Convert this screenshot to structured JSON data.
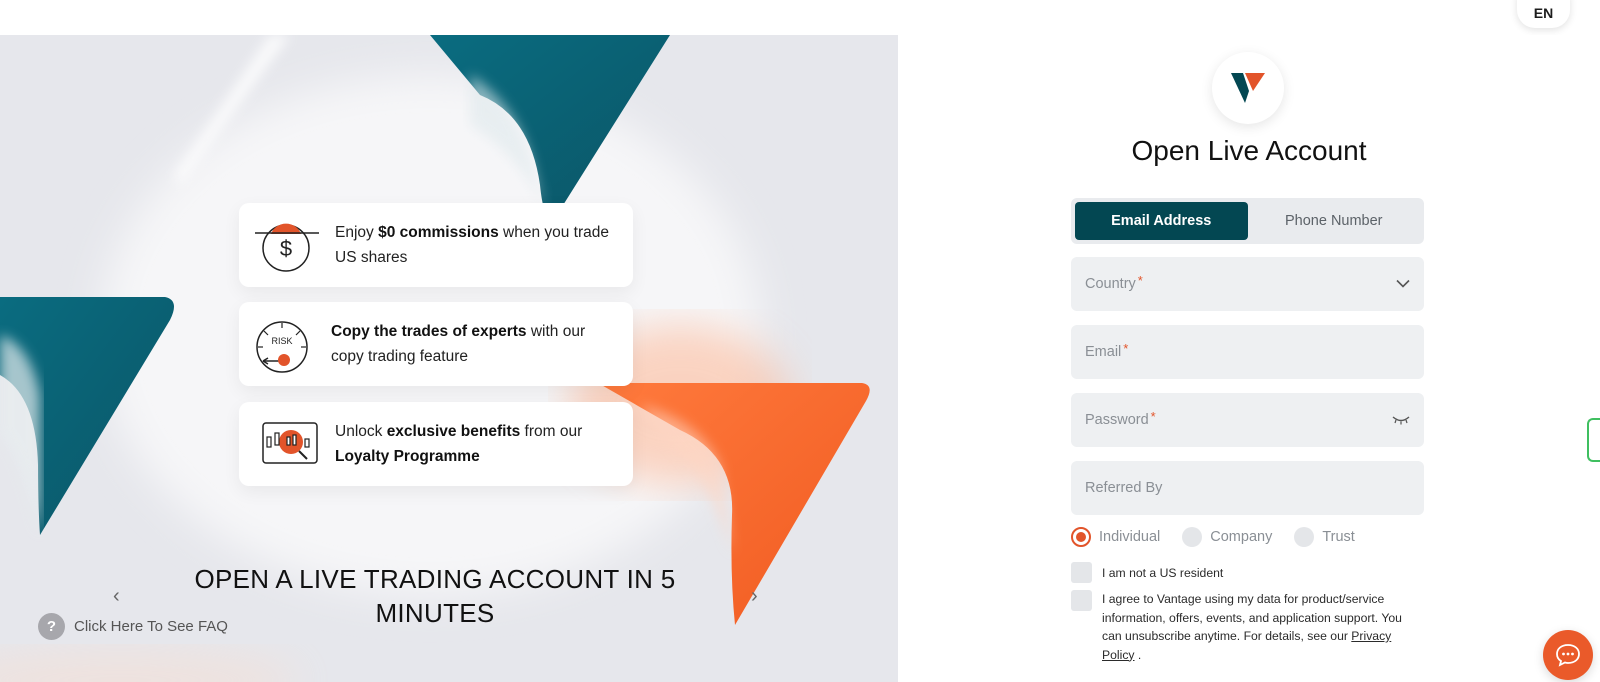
{
  "header": {
    "language": "EN"
  },
  "hero": {
    "features": [
      {
        "icon": "dollar-coin-icon",
        "pre": "Enjoy ",
        "bold": "$0 commissions",
        "post": " when you trade US shares"
      },
      {
        "icon": "risk-gauge-icon",
        "pre": "",
        "bold": "Copy the trades of experts",
        "post": " with our copy trading feature"
      },
      {
        "icon": "loyalty-chart-icon",
        "pre": "Unlock ",
        "bold": "exclusive benefits",
        "post": " from our ",
        "bold2": "Loyalty Programme"
      }
    ],
    "risk_label": "RISK",
    "title": "OPEN A LIVE TRADING ACCOUNT IN 5 MINUTES",
    "prev_arrow": "‹",
    "next_arrow": "›",
    "faq": {
      "icon": "?",
      "label": "Click Here To See FAQ"
    }
  },
  "form": {
    "title": "Open Live Account",
    "tabs": [
      {
        "label": "Email Address",
        "active": true
      },
      {
        "label": "Phone Number",
        "active": false
      }
    ],
    "fields": {
      "country": {
        "placeholder": "Country",
        "required": "*"
      },
      "email": {
        "placeholder": "Email",
        "required": "*"
      },
      "password": {
        "placeholder": "Password",
        "required": "*"
      },
      "referred_by": {
        "placeholder": "Referred By"
      }
    },
    "account_types": [
      {
        "label": "Individual",
        "checked": true
      },
      {
        "label": "Company",
        "checked": false
      },
      {
        "label": "Trust",
        "checked": false
      }
    ],
    "us_resident_label": "I am not a US resident",
    "consent_text": "I agree to Vantage using my data for product/service information, offers, events, and application support. You can unsubscribe anytime. For details, see our",
    "privacy_link": "Privacy Policy",
    "consent_end": "."
  },
  "colors": {
    "brand_teal": "#034752",
    "brand_orange": "#e2542a",
    "field_bg": "#eef0f2"
  }
}
